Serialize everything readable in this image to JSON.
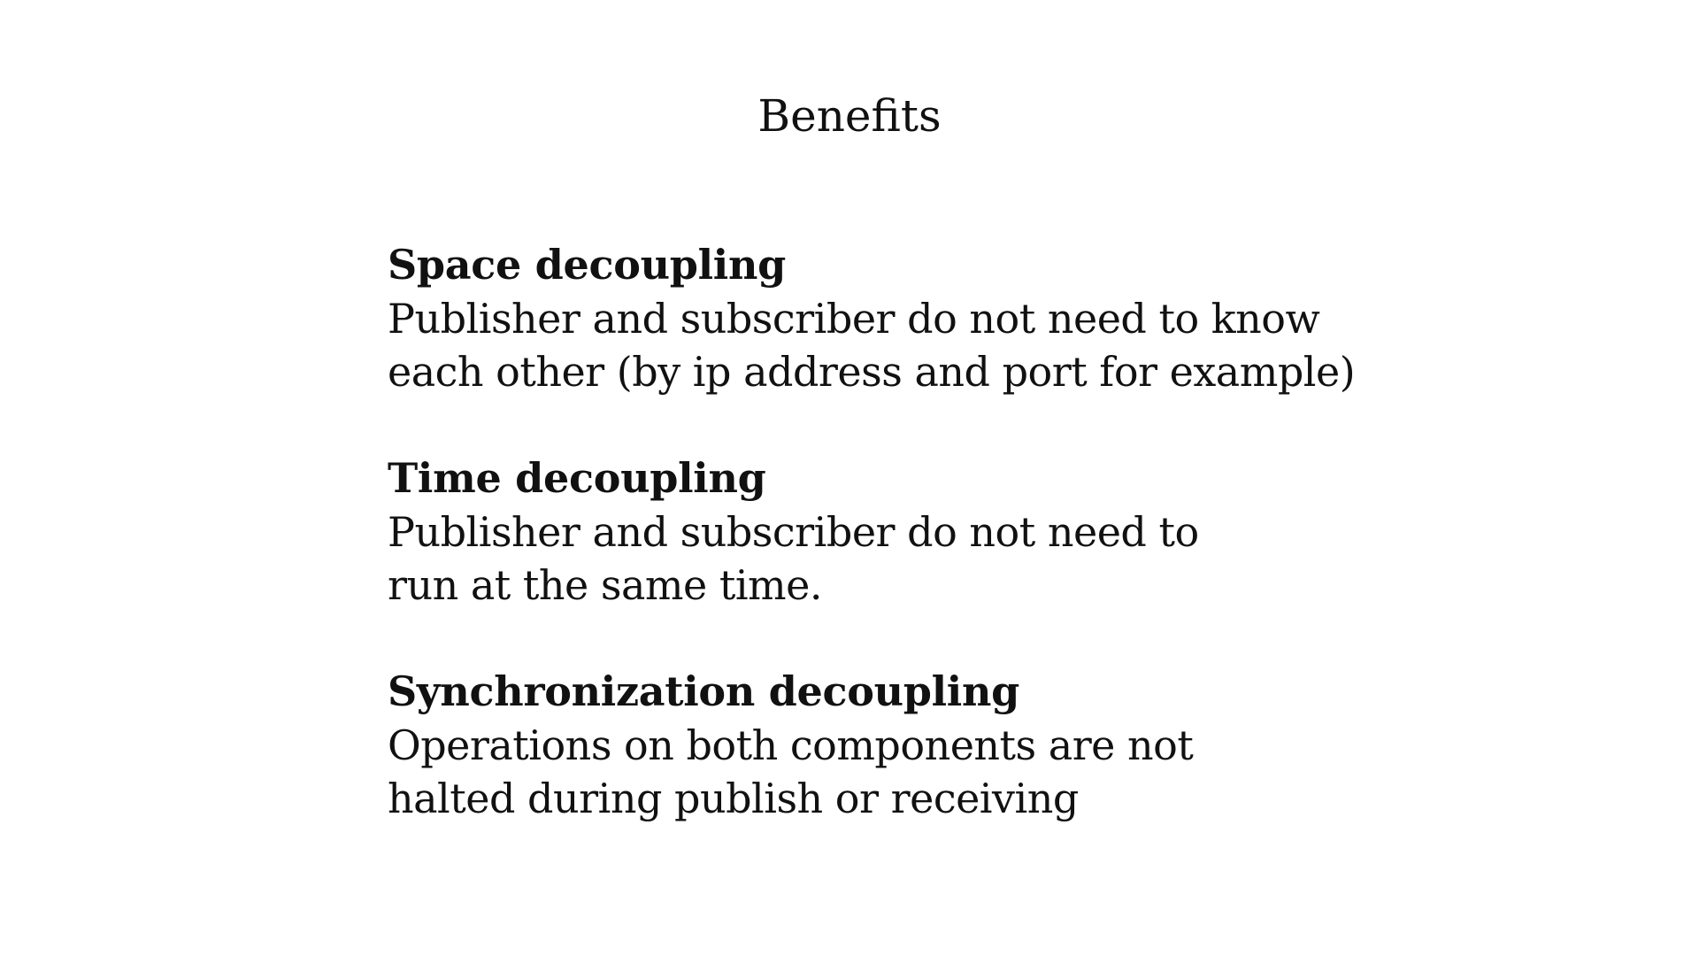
{
  "slide": {
    "title": "Benefits",
    "sections": [
      {
        "heading": "Space decoupling",
        "lines": [
          "Publisher and subscriber do not need to know",
          "each other (by ip address and port for example)"
        ]
      },
      {
        "heading": "Time decoupling",
        "lines": [
          "Publisher and subscriber do not need to",
          "run at the same time."
        ]
      },
      {
        "heading": "Synchronization decoupling",
        "lines": [
          "Operations on both components are not",
          "halted during publish or receiving"
        ]
      }
    ]
  }
}
